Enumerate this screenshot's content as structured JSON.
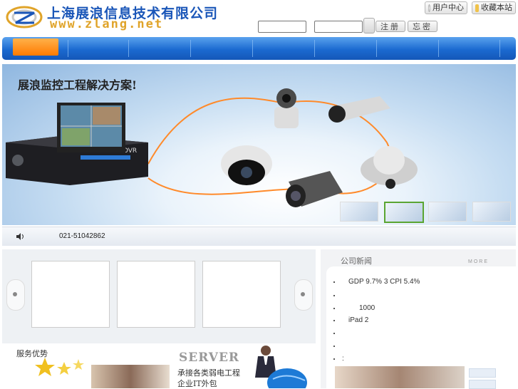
{
  "header": {
    "company_name": "上海展浪信息技术有限公司",
    "logo_url_text": "www.zlang.net",
    "user_center": "用户中心",
    "bookmark": "收藏本站",
    "register": "注册",
    "forgot": "忘密"
  },
  "banner": {
    "title": "展浪监控工程解决方案!",
    "dvr_label": "DVR"
  },
  "contact": {
    "phone": "021-51042862"
  },
  "news": {
    "heading": "公司新闻",
    "more": "MORE",
    "items": [
      "GDP 9.7% 3 CPI 5.4%",
      "",
      "1000",
      "iPad 2",
      "",
      "",
      ":"
    ]
  },
  "services": {
    "heading": "服务优势",
    "english": "SERVER",
    "line1": "承接各类弱电工程",
    "line2": "企业IT外包"
  },
  "colors": {
    "nav_blue": "#1b6ad0",
    "nav_active": "#ff8a10"
  }
}
